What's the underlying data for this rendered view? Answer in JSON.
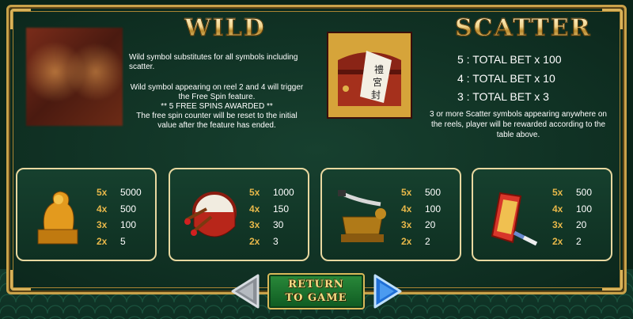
{
  "wild": {
    "title": "WILD",
    "desc_line1": "Wild symbol substitutes for all symbols including scatter.",
    "desc_line2": "Wild symbol appearing on reel 2 and 4 will trigger the Free Spin feature.",
    "desc_line3": "** 5 FREE SPINS AWARDED **",
    "desc_line4": "The free spin counter will be reset to the initial value after the feature has ended."
  },
  "scatter": {
    "title": "SCATTER",
    "payouts": [
      "5 : TOTAL BET x 100",
      "4 : TOTAL BET x 10",
      "3 : TOTAL BET x 3"
    ],
    "desc": "3 or more Scatter symbols appearing anywhere on the reels, player will be rewarded according to the table above."
  },
  "paytable": [
    {
      "icon": "golden-lion-seal-icon",
      "rows": [
        {
          "mult": "5x",
          "val": "5000"
        },
        {
          "mult": "4x",
          "val": "500"
        },
        {
          "mult": "3x",
          "val": "100"
        },
        {
          "mult": "2x",
          "val": "5"
        }
      ]
    },
    {
      "icon": "drum-icon",
      "rows": [
        {
          "mult": "5x",
          "val": "1000"
        },
        {
          "mult": "4x",
          "val": "150"
        },
        {
          "mult": "3x",
          "val": "30"
        },
        {
          "mult": "2x",
          "val": "3"
        }
      ]
    },
    {
      "icon": "sword-stand-icon",
      "rows": [
        {
          "mult": "5x",
          "val": "500"
        },
        {
          "mult": "4x",
          "val": "100"
        },
        {
          "mult": "3x",
          "val": "20"
        },
        {
          "mult": "2x",
          "val": "2"
        }
      ]
    },
    {
      "icon": "scroll-brush-icon",
      "rows": [
        {
          "mult": "5x",
          "val": "500"
        },
        {
          "mult": "4x",
          "val": "100"
        },
        {
          "mult": "3x",
          "val": "20"
        },
        {
          "mult": "2x",
          "val": "2"
        }
      ]
    }
  ],
  "nav": {
    "return_line1": "RETURN",
    "return_line2": "TO GAME",
    "prev_icon": "triangle-left-icon",
    "next_icon": "triangle-right-icon"
  },
  "colors": {
    "gold": "#c9a24a",
    "multiplier": "#e8b84a",
    "panel": "#0f2f22"
  }
}
